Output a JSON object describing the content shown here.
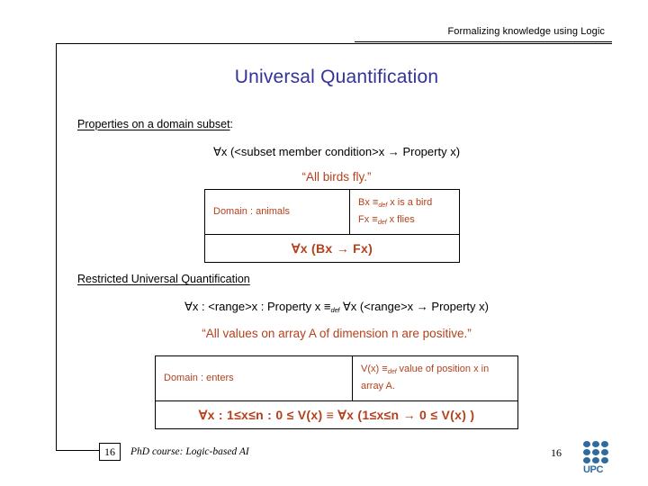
{
  "header": {
    "text": "Formalizing knowledge using Logic"
  },
  "title": "Universal Quantification",
  "title_color": "#33339a",
  "accent_color": "#b5401c",
  "sections": [
    {
      "heading": "Properties on a domain subset",
      "heading_suffix": ":",
      "formula_prefix": "∀x (<subset member condition>x ",
      "formula_arrow": "→",
      "formula_suffix": " Property x)",
      "quote": "“All birds fly.”",
      "table": {
        "domain_label": "Domain : animals",
        "definitions": [
          {
            "symbol": "Bx ",
            "equiv": "≡",
            "sub": "def",
            "meaning": " x is a bird"
          },
          {
            "symbol": "Fx ",
            "equiv": "≡",
            "sub": "def",
            "meaning": " x flies"
          }
        ],
        "conclusion": "∀x (Bx → Fx)"
      }
    },
    {
      "heading": "Restricted Universal Quantification",
      "heading_suffix": "",
      "formula_left": "∀x : <range>x : Property x  ",
      "formula_equiv": "≡",
      "formula_sub": "def",
      "formula_right": "  ∀x (<range>x → Property x)",
      "quote": "“All values on array A of dimension n are positive.”",
      "table": {
        "domain_label": "Domain : enters",
        "definition": {
          "symbol": "V(x) ",
          "equiv": "≡",
          "sub": "def",
          "meaning": " value of position x in array A."
        },
        "conclusion": "∀x : 1≤x≤n : 0 ≤ V(x) ≡ ∀x (1≤x≤n → 0 ≤ V(x) )"
      }
    }
  ],
  "footer": {
    "page_box": "16",
    "course": "PhD course: Logic-based AI",
    "page_number": "16",
    "logo_text": "UPC",
    "logo_color": "#2f6b9e"
  }
}
